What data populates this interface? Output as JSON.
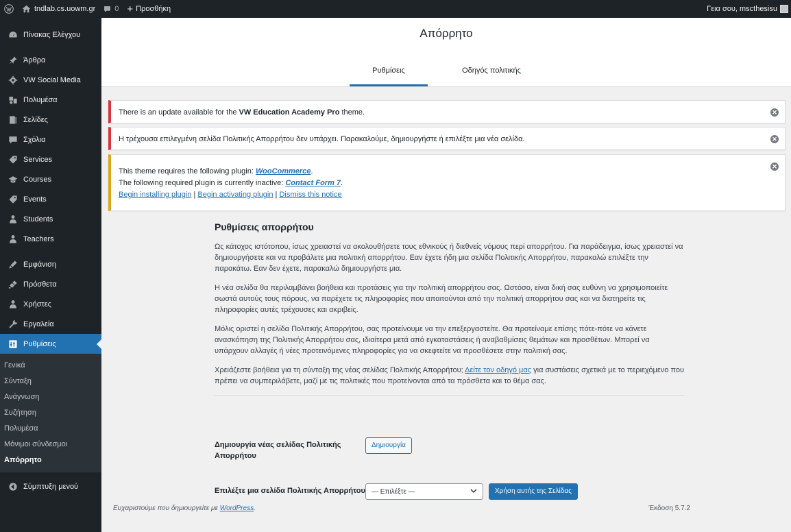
{
  "adminbar": {
    "site_name": "tndlab.cs.uowm.gr",
    "comments_count": "0",
    "new_label": "Προσθήκη",
    "greeting": "Γεια σου, mscthesisu"
  },
  "sidebar": {
    "items": [
      {
        "label": "Πίνακας Ελέγχου",
        "icon": "dashboard-icon"
      },
      {
        "label": "Άρθρα",
        "icon": "pin-icon"
      },
      {
        "label": "VW Social Media",
        "icon": "gear-icon"
      },
      {
        "label": "Πολυμέσα",
        "icon": "media-icon"
      },
      {
        "label": "Σελίδες",
        "icon": "pages-icon"
      },
      {
        "label": "Σχόλια",
        "icon": "comment-icon"
      },
      {
        "label": "Services",
        "icon": "tag-icon"
      },
      {
        "label": "Courses",
        "icon": "courses-icon"
      },
      {
        "label": "Events",
        "icon": "tag-icon"
      },
      {
        "label": "Students",
        "icon": "users-icon"
      },
      {
        "label": "Teachers",
        "icon": "users-icon"
      },
      {
        "label": "Εμφάνιση",
        "icon": "appearance-icon"
      },
      {
        "label": "Πρόσθετα",
        "icon": "plugin-icon"
      },
      {
        "label": "Χρήστες",
        "icon": "user-icon"
      },
      {
        "label": "Εργαλεία",
        "icon": "wrench-icon"
      },
      {
        "label": "Ρυθμίσεις",
        "icon": "settings-icon"
      }
    ],
    "submenu": [
      "Γενικά",
      "Σύνταξη",
      "Ανάγνωση",
      "Συζήτηση",
      "Πολυμέσα",
      "Μόνιμοι σύνδεσμοι",
      "Απόρρητο"
    ],
    "collapse_label": "Σύμπτυξη μενού"
  },
  "header": {
    "title": "Απόρρητο",
    "tabs": [
      "Ρυθμίσεις",
      "Οδηγός πολιτικής"
    ]
  },
  "notices": {
    "update": {
      "pre": "There is an update available for the ",
      "theme": "VW Education Academy Pro",
      "post": " theme."
    },
    "privacy_missing": "Η τρέχουσα επιλεγμένη σελίδα Πολιτικής Απορρήτου δεν υπάρχει. Παρακαλούμε, δημιουργήστε ή επιλέξτε μια νέα σελίδα.",
    "plugins": {
      "line1_pre": "This theme requires the following plugin: ",
      "line1_link": "WooCommerce",
      "line1_post": ".",
      "line2_pre": "The following required plugin is currently inactive: ",
      "line2_link": "Contact Form 7",
      "line2_post": ".",
      "action_install": "Begin installing plugin",
      "action_activate": "Begin activating plugin",
      "action_dismiss": "Dismiss this notice",
      "separator": " | "
    }
  },
  "content": {
    "heading": "Ρυθμίσεις απορρήτου",
    "p1": "Ως κάτοχος ιστότοπου, ίσως χρειαστεί να ακολουθήσετε τους εθνικούς ή διεθνείς νόμους περί απορρήτου. Για παράδειγμα, ίσως χρειαστεί να δημιουργήσετε και να προβάλετε μια πολιτική απορρήτου. Εαν έχετε ήδη μια σελίδα Πολιτικής Απορρήτου, παρακαλώ επιλέξτε την παρακάτω. Εαν δεν έχετε, παρακαλώ δημιουργήστε μια.",
    "p2": "Η νέα σελίδα θα περιλαμβάνει βοήθεια και προτάσεις για την πολιτική απορρήτου σας. Ωστόσο, είναι δική σας ευθύνη να χρησιμοποιείτε σωστά αυτούς τους πόρους, να παρέχετε τις πληροφορίες που απαιτούνται από την πολιτική απορρήτου σας και να διατηρείτε τις πληροφορίες αυτές τρέχουσες και ακριβείς.",
    "p3": "Μόλις οριστεί η σελίδα Πολιτικής Απορρήτου, σας προτείνουμε να την επεξεργαστείτε. Θα προτείναμε επίσης πότε-πότε να κάνετε ανασκόπηση της Πολιτικής Απορρήτου σας, ιδιαίτερα μετά από εγκαταστάσεις ή αναβαθμίσεις θεμάτων και προσθέτων. Μπορεί να υπάρχουν αλλαγές ή νέες προτεινόμενες πληροφορίες για να σκεφτείτε να προσθέσετε στην πολιτική σας.",
    "p4_pre": "Χρειάζεστε βοήθεια για τη σύνταξη της νέας σελίδας Πολιτικής Απορρήτου; ",
    "p4_link": "Δείτε τον οδηγό μας",
    "p4_post": " για συστάσεις σχετικά με το περιεχόμενο που πρέπει να συμπεριλάβετε, μαζί με τις πολιτικές που προτείνονται από τα πρόσθετα και το θέμα σας.",
    "create_label": "Δημιουργία νέας σελίδας Πολιτικής Απορρήτου",
    "create_button": "Δημιουργία",
    "select_label": "Επιλέξτε μια σελίδα Πολιτικής Απορρήτου",
    "select_value": "— Επιλέξτε —",
    "use_button": "Χρήση αυτής της Σελίδας"
  },
  "footer": {
    "thanks_pre": "Ευχαριστούμε που δημιουργείτε με ",
    "thanks_link": "WordPress",
    "thanks_post": ".",
    "version": "Έκδοση 5.7.2"
  }
}
